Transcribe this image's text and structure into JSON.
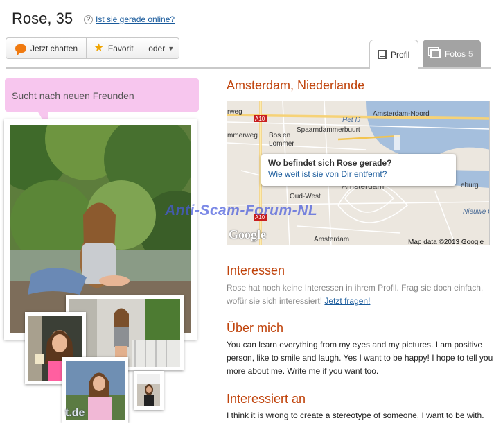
{
  "header": {
    "name_age": "Rose, 35",
    "help_icon": "question-icon",
    "online_link": "Ist sie gerade online?"
  },
  "actions": {
    "chat_label": "Jetzt chatten",
    "favorite_label": "Favorit",
    "more_label": "oder"
  },
  "tabs": {
    "profile_label": "Profil",
    "photos_label": "Fotos",
    "photos_count": "5"
  },
  "status": {
    "text": "Sucht nach neuen Freunden"
  },
  "location": {
    "title": "Amsterdam, Niederlande",
    "popup_question": "Wo befindet sich Rose gerade?",
    "popup_link": "Wie weit ist sie von Dir entfernt?",
    "map_copyright": "Map data ©2013 Google",
    "map_logo": "Google",
    "map_labels": [
      "Amsterdam-Noord",
      "Spaarndammerbuurt",
      "Bos en Lommer",
      "Oud-West",
      "Amsterdam",
      "Amsterdam",
      "Nieuwe Ow",
      "A10",
      "A10",
      "A10",
      "rweg",
      "mmerweg",
      "Het IJ",
      "eburg"
    ]
  },
  "interests": {
    "title": "Interessen",
    "text": "Rose hat noch keine Interessen in ihrem Profil. Frag sie doch einfach, wofür sie sich interessiert!",
    "link": "Jetzt fragen!"
  },
  "about": {
    "title": "Über mich",
    "text": "You can learn everything from my eyes and my pictures. I am positive person, like to smile and laugh. Yes I want to be happy! I hope to tell you more about me. Write me if you want too."
  },
  "interested_in": {
    "title": "Interessiert an",
    "text": "I think it is wrong to create a stereotype of someone, I want to be with."
  },
  "watermark": {
    "text": "Anti-Scam-Forum-NL",
    "corner_text": "t.de"
  },
  "colors": {
    "accent_heading": "#c0430b",
    "link": "#1a5b9c",
    "bubble": "#f7c6ee",
    "tab_inactive": "#a3a3a3"
  }
}
